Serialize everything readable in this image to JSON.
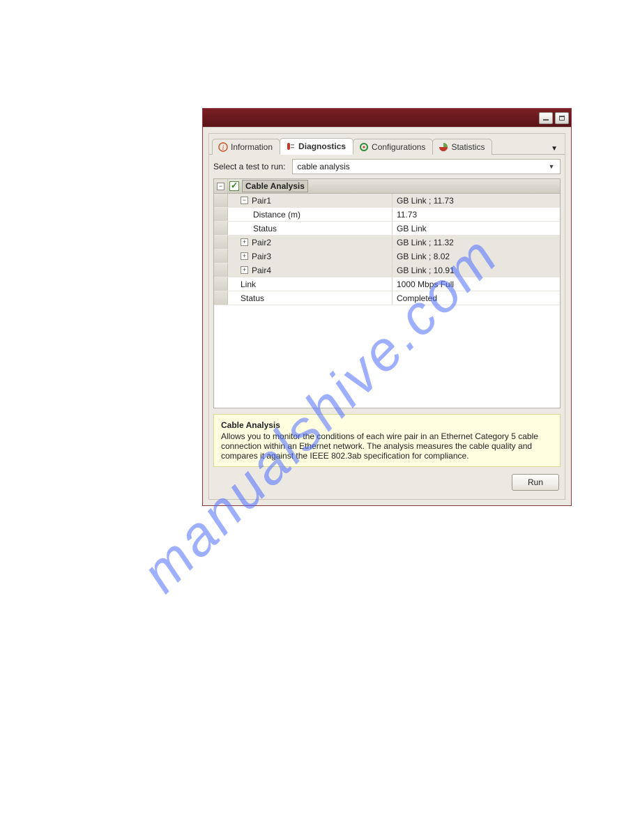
{
  "watermark": "manualshive.com",
  "tabs": {
    "information": "Information",
    "diagnostics": "Diagnostics",
    "configurations": "Configurations",
    "statistics": "Statistics"
  },
  "select_row": {
    "label": "Select a test to run:",
    "value": "cable analysis"
  },
  "tree": {
    "header": "Cable Analysis",
    "rows": [
      {
        "name": "Pair1",
        "value": "GB Link ; 11.73",
        "expander": "−",
        "indent": 1,
        "shaded": true
      },
      {
        "name": "Distance (m)",
        "value": "11.73",
        "expander": "",
        "indent": 2,
        "shaded": false
      },
      {
        "name": "Status",
        "value": "GB Link",
        "expander": "",
        "indent": 2,
        "shaded": false
      },
      {
        "name": "Pair2",
        "value": "GB Link ; 11.32",
        "expander": "+",
        "indent": 1,
        "shaded": true
      },
      {
        "name": "Pair3",
        "value": "GB Link ; 8.02",
        "expander": "+",
        "indent": 1,
        "shaded": true
      },
      {
        "name": "Pair4",
        "value": "GB Link ; 10.91",
        "expander": "+",
        "indent": 1,
        "shaded": true
      },
      {
        "name": "Link",
        "value": "1000 Mbps Full",
        "expander": "",
        "indent": 1,
        "shaded": false
      },
      {
        "name": "Status",
        "value": "Completed",
        "expander": "",
        "indent": 1,
        "shaded": false
      }
    ]
  },
  "infobox": {
    "title": "Cable Analysis",
    "body": "Allows you to monitor the conditions of each wire pair in an Ethernet Category 5 cable connection within an Ethernet network. The analysis measures the cable quality and compares it against the IEEE 802.3ab specification for compliance."
  },
  "buttons": {
    "run": "Run"
  }
}
